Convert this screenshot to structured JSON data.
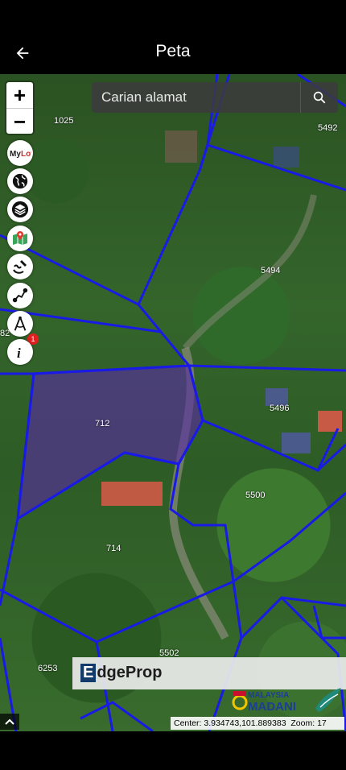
{
  "header": {
    "title": "Peta"
  },
  "search": {
    "placeholder": "Carian alamat"
  },
  "zoom": {
    "in_label": "+",
    "out_label": "−"
  },
  "tools": [
    {
      "name": "mylot",
      "label": "MyLot"
    },
    {
      "name": "globe"
    },
    {
      "name": "layers"
    },
    {
      "name": "map-pin"
    },
    {
      "name": "sketch"
    },
    {
      "name": "measure"
    },
    {
      "name": "compass-draw"
    },
    {
      "name": "info",
      "label": "i"
    }
  ],
  "badge": {
    "count": "1"
  },
  "lots": [
    {
      "id": "1025"
    },
    {
      "id": "5492"
    },
    {
      "id": "5494"
    },
    {
      "id": "82"
    },
    {
      "id": "712"
    },
    {
      "id": "5496"
    },
    {
      "id": "5500"
    },
    {
      "id": "714"
    },
    {
      "id": "5502"
    },
    {
      "id": "6253"
    }
  ],
  "banner": {
    "logo_mark": "E",
    "logo_text": "dgeProp",
    "madani_text": "MALAYSIA MADANI"
  },
  "status": {
    "center_label": "Center:",
    "center_value": "3.934743,101.889383",
    "zoom_label": "Zoom:",
    "zoom_value": "17"
  },
  "colors": {
    "parcel_line": "#1a1ae6",
    "selected_parcel": "#5a2aa8",
    "header_bg": "#000000"
  }
}
